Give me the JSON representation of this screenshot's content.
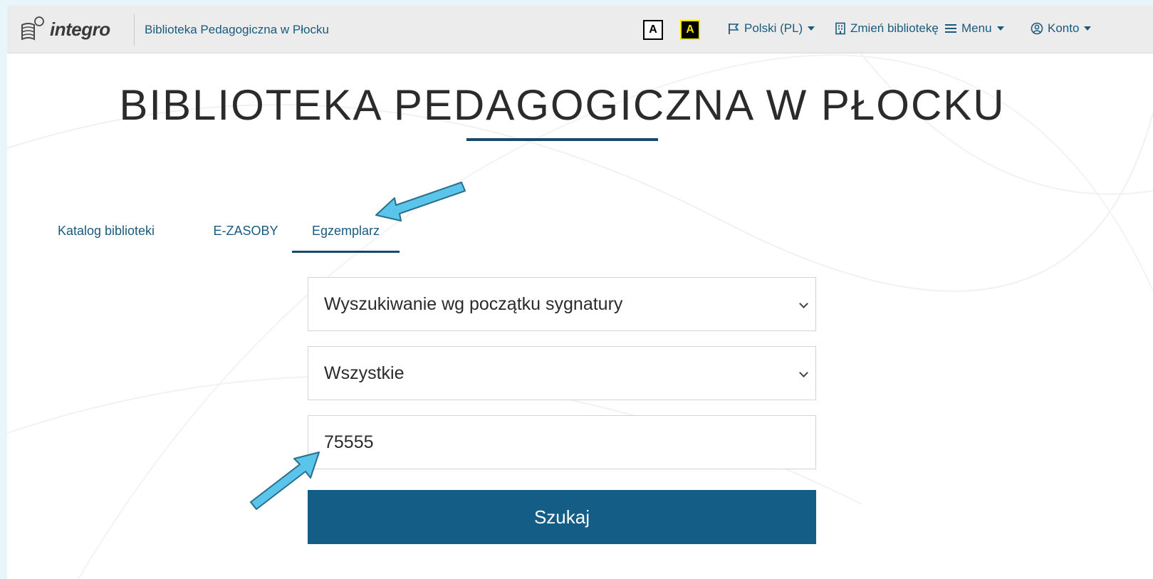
{
  "header": {
    "logo_text": "integro",
    "library_name": "Biblioteka Pedagogiczna w Płocku",
    "contrast_normal_label": "A",
    "contrast_high_label": "A",
    "language_label": "Polski (PL)",
    "change_library_label": "Zmień bibliotekę",
    "menu_label": "Menu",
    "account_label": "Konto"
  },
  "page": {
    "title": "BIBLIOTEKA PEDAGOGICZNA W PŁOCKU"
  },
  "tabs": [
    {
      "label": "Katalog biblioteki",
      "active": false
    },
    {
      "label": "E-ZASOBY",
      "active": false
    },
    {
      "label": "Egzemplarz",
      "active": true
    }
  ],
  "form": {
    "search_type_value": "Wyszukiwanie wg początku sygnatury",
    "scope_value": "Wszystkie",
    "query_value": "75555",
    "search_label": "Szukaj"
  },
  "colors": {
    "accent": "#154a6a",
    "button": "#145d86",
    "link": "#1a5a7c",
    "annotation_arrow": "#5bc4ea"
  }
}
